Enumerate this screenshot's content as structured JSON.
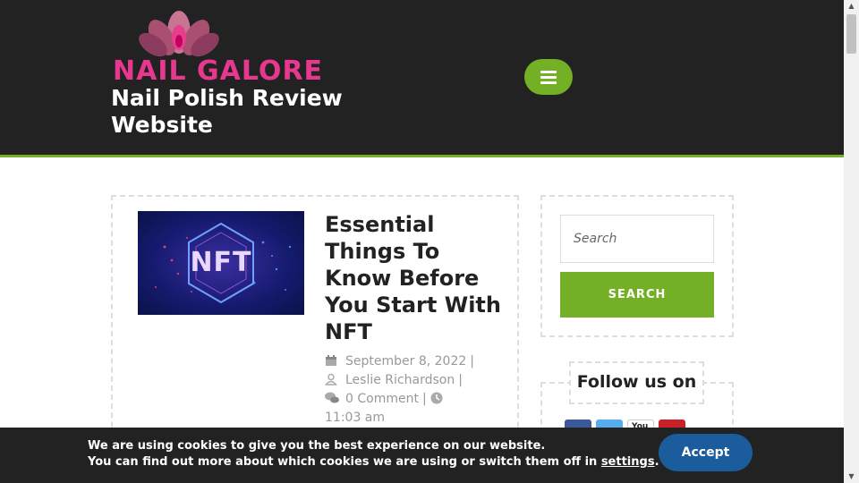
{
  "header": {
    "logo_text": "NAIL GALORE",
    "site_title": "Nail Polish Review Website",
    "menu_icon": "hamburger-menu-icon",
    "accent_color": "#74b025",
    "logo_color": "#e8378e"
  },
  "post": {
    "thumbnail_text": "NFT",
    "title": "Essential Things To Know Before You Start With NFT",
    "date": "September 8, 2022",
    "author": "Leslie Richardson",
    "comments": "0 Comment",
    "time": "11:03 am",
    "separator": "|"
  },
  "sidebar": {
    "search_placeholder": "Search",
    "search_button": "SEARCH",
    "follow_title": "Follow us on",
    "social_icons": [
      "facebook-icon",
      "twitter-icon",
      "youtube-icon",
      "pinterest-icon"
    ]
  },
  "cookie": {
    "line1": "We are using cookies to give you the best experience on our website.",
    "line2_prefix": "You can find out more about which cookies we are using or switch them off in ",
    "settings_link": "settings",
    "line2_suffix": ".",
    "accept_label": "Accept"
  }
}
